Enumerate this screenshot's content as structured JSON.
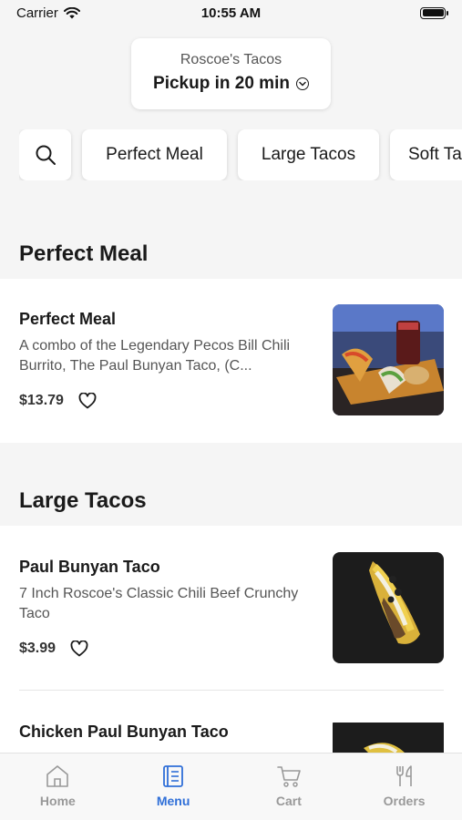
{
  "status": {
    "carrier": "Carrier",
    "time": "10:55 AM"
  },
  "store": {
    "name": "Roscoe's Tacos",
    "pickup": "Pickup in 20 min"
  },
  "categories": [
    "Perfect Meal",
    "Large Tacos",
    "Soft Ta"
  ],
  "sections": [
    {
      "title": "Perfect Meal",
      "items": [
        {
          "name": "Perfect Meal",
          "description": "A combo of the Legendary Pecos Bill Chili Burrito, The Paul Bunyan Taco, (C...",
          "price": "$13.79"
        }
      ]
    },
    {
      "title": "Large Tacos",
      "items": [
        {
          "name": "Paul Bunyan Taco",
          "description": "7 Inch Roscoe's Classic Chili Beef Crunchy Taco",
          "price": "$3.99"
        },
        {
          "name": "Chicken Paul Bunyan Taco",
          "description": "",
          "price": ""
        }
      ]
    }
  ],
  "tabs": [
    {
      "label": "Home",
      "icon": "home-icon",
      "active": false
    },
    {
      "label": "Menu",
      "icon": "menu-book-icon",
      "active": true
    },
    {
      "label": "Cart",
      "icon": "cart-icon",
      "active": false
    },
    {
      "label": "Orders",
      "icon": "fork-knife-icon",
      "active": false
    }
  ],
  "colors": {
    "accent": "#2f6fd8",
    "inactive": "#999999",
    "background": "#f5f5f5"
  }
}
